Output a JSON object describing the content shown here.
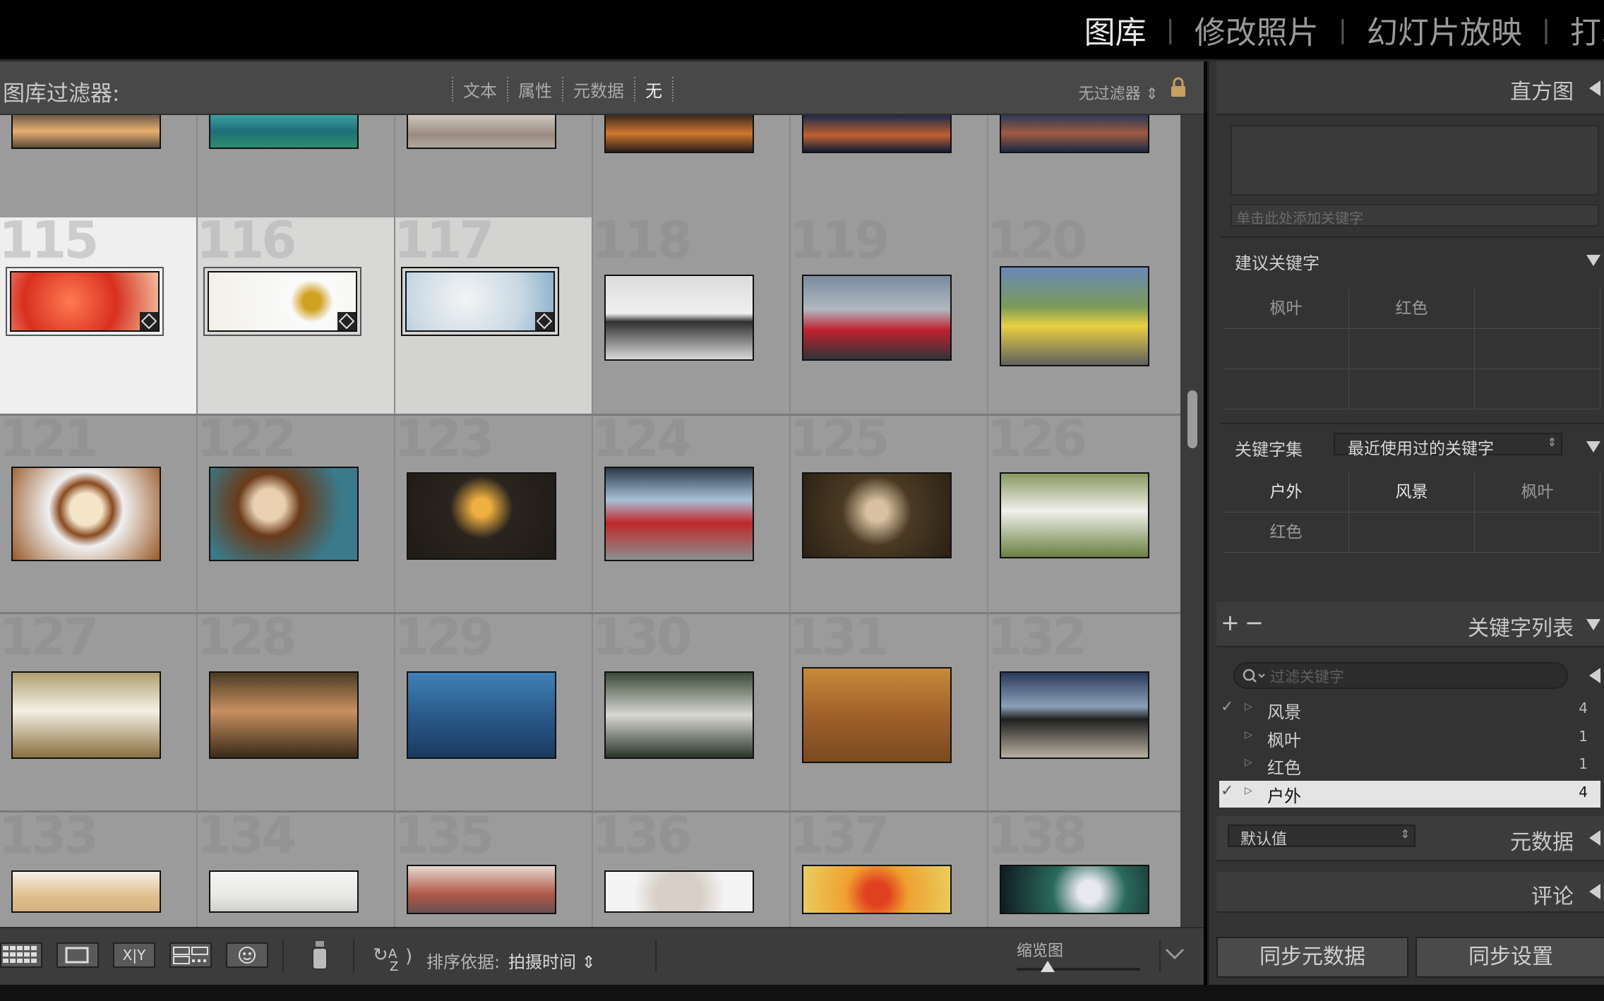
{
  "modules": [
    {
      "label": "图库",
      "active": true
    },
    {
      "label": "修改照片",
      "active": false
    },
    {
      "label": "幻灯片放映",
      "active": false
    },
    {
      "label": "打印",
      "active": false
    }
  ],
  "module_separator": "|",
  "filter_bar": {
    "label": "图库过滤器:",
    "tabs": [
      {
        "label": "文本",
        "active": false
      },
      {
        "label": "属性",
        "active": false
      },
      {
        "label": "元数据",
        "active": false
      },
      {
        "label": "无",
        "active": true
      }
    ],
    "preset": "无过滤器 ⇕"
  },
  "grid": {
    "cells": [
      {
        "num": "",
        "thumb": "street-evening"
      },
      {
        "num": "",
        "thumb": "lake-reflection"
      },
      {
        "num": "",
        "thumb": "golden-gate-fog"
      },
      {
        "num": "",
        "thumb": "city-night-lights"
      },
      {
        "num": "",
        "thumb": "pagoda-night"
      },
      {
        "num": "",
        "thumb": "castle-river-night"
      },
      {
        "num": "115",
        "thumb": "red-flowers",
        "selected": 1,
        "badge": true
      },
      {
        "num": "116",
        "thumb": "daisy",
        "selected": 2,
        "badge": true
      },
      {
        "num": "117",
        "thumb": "white-blossom",
        "selected": 3,
        "badge": true
      },
      {
        "num": "118",
        "thumb": "black-porsche-snow"
      },
      {
        "num": "119",
        "thumb": "red-sports-car"
      },
      {
        "num": "120",
        "thumb": "yellow-porsche"
      },
      {
        "num": "121",
        "thumb": "latte-art"
      },
      {
        "num": "122",
        "thumb": "coffee-cookies"
      },
      {
        "num": "123",
        "thumb": "coffee-table-top"
      },
      {
        "num": "124",
        "thumb": "woman-red-dress"
      },
      {
        "num": "125",
        "thumb": "woman-portrait-dark"
      },
      {
        "num": "126",
        "thumb": "woman-grass-sunglasses"
      },
      {
        "num": "127",
        "thumb": "woman-hay-white-dress"
      },
      {
        "num": "128",
        "thumb": "woman-forest-log"
      },
      {
        "num": "129",
        "thumb": "woman-street-blue"
      },
      {
        "num": "130",
        "thumb": "woman-lying-grass"
      },
      {
        "num": "131",
        "thumb": "autumn-bench"
      },
      {
        "num": "132",
        "thumb": "woman-rock-black-dress"
      },
      {
        "num": "133",
        "thumb": "woman-blonde-closeup"
      },
      {
        "num": "134",
        "thumb": "woman-white-sofa"
      },
      {
        "num": "135",
        "thumb": "woman-road"
      },
      {
        "num": "136",
        "thumb": "white-cat"
      },
      {
        "num": "137",
        "thumb": "bird-of-paradise"
      },
      {
        "num": "138",
        "thumb": "white-bird-bokeh"
      }
    ]
  },
  "toolbar": {
    "grid_view_icon": "grid-icon",
    "loupe_view_icon": "loupe-icon",
    "compare_label": "X|Y",
    "survey_icon": "survey-icon",
    "people_icon": "face-icon",
    "spray_icon": "painter-icon",
    "sort_icon": "sort-az-icon",
    "sort_label": "排序依据:",
    "sort_value": "拍摄时间 ⇕",
    "thumb_label": "缩览图",
    "thumb_size": 0.25
  },
  "right_panel": {
    "histogram": "直方图",
    "keyword_placeholder": "单击此处添加关键字",
    "suggested": {
      "title": "建议关键字",
      "cells": [
        "枫叶",
        "红色",
        "",
        "",
        "",
        "",
        "",
        "",
        ""
      ]
    },
    "keyword_set": {
      "title": "关键字集",
      "select": "最近使用过的关键字",
      "cells": [
        {
          "label": "户外",
          "hi": true
        },
        {
          "label": "风景",
          "hi": true
        },
        {
          "label": "枫叶",
          "hi": false
        },
        {
          "label": "红色",
          "hi": false
        },
        {
          "label": "",
          "hi": false
        },
        {
          "label": "",
          "hi": false
        }
      ]
    },
    "keyword_list": {
      "add": "+",
      "remove": "−",
      "title": "关键字列表",
      "search_placeholder": "过滤关键字",
      "items": [
        {
          "name": "风景",
          "count": "4",
          "checked": true,
          "selected": false
        },
        {
          "name": "枫叶",
          "count": "1",
          "checked": false,
          "selected": false
        },
        {
          "name": "红色",
          "count": "1",
          "checked": false,
          "selected": false
        },
        {
          "name": "户外",
          "count": "4",
          "checked": true,
          "selected": true
        }
      ]
    },
    "metadata": {
      "preset": "默认值",
      "title": "元数据"
    },
    "comments": {
      "title": "评论"
    },
    "sync_metadata": "同步元数据",
    "sync_settings": "同步设置"
  },
  "colors": {
    "accent_panel": "#333333",
    "grid_bg": "#9b9b9b",
    "selected_cell": "#efefef"
  }
}
